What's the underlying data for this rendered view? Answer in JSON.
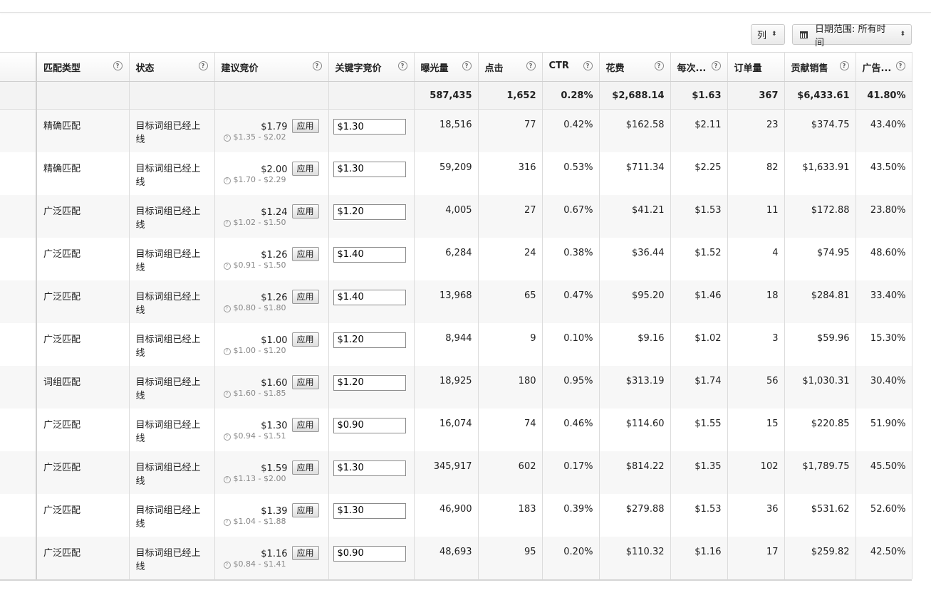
{
  "toolbar": {
    "columns_label": "列",
    "date_range_label": "日期范围: 所有时间"
  },
  "headers": [
    "匹配类型",
    "状态",
    "建议竞价",
    "关键字竞价",
    "曝光量",
    "点击",
    "CTR",
    "花费",
    "每次...",
    "订单量",
    "贡献销售",
    "广告..."
  ],
  "totals": {
    "impressions": "587,435",
    "clicks": "1,652",
    "ctr": "0.28%",
    "spend": "$2,688.14",
    "cpc": "$1.63",
    "orders": "367",
    "sales": "$6,433.61",
    "acos": "41.80%"
  },
  "apply_label": "应用",
  "rows": [
    {
      "match": "精确匹配",
      "status": "目标词组已经上线",
      "suggested": "$1.79",
      "range": "$1.35 - $2.02",
      "bid": "$1.30",
      "impressions": "18,516",
      "clicks": "77",
      "ctr": "0.42%",
      "spend": "$162.58",
      "cpc": "$2.11",
      "orders": "23",
      "sales": "$374.75",
      "acos": "43.40%"
    },
    {
      "match": "精确匹配",
      "status": "目标词组已经上线",
      "suggested": "$2.00",
      "range": "$1.70 - $2.29",
      "bid": "$1.30",
      "impressions": "59,209",
      "clicks": "316",
      "ctr": "0.53%",
      "spend": "$711.34",
      "cpc": "$2.25",
      "orders": "82",
      "sales": "$1,633.91",
      "acos": "43.50%"
    },
    {
      "match": "广泛匹配",
      "status": "目标词组已经上线",
      "suggested": "$1.24",
      "range": "$1.02 - $1.50",
      "bid": "$1.20",
      "impressions": "4,005",
      "clicks": "27",
      "ctr": "0.67%",
      "spend": "$41.21",
      "cpc": "$1.53",
      "orders": "11",
      "sales": "$172.88",
      "acos": "23.80%"
    },
    {
      "match": "广泛匹配",
      "status": "目标词组已经上线",
      "suggested": "$1.26",
      "range": "$0.91 - $1.50",
      "bid": "$1.40",
      "impressions": "6,284",
      "clicks": "24",
      "ctr": "0.38%",
      "spend": "$36.44",
      "cpc": "$1.52",
      "orders": "4",
      "sales": "$74.95",
      "acos": "48.60%"
    },
    {
      "match": "广泛匹配",
      "status": "目标词组已经上线",
      "suggested": "$1.26",
      "range": "$0.80 - $1.80",
      "bid": "$1.40",
      "impressions": "13,968",
      "clicks": "65",
      "ctr": "0.47%",
      "spend": "$95.20",
      "cpc": "$1.46",
      "orders": "18",
      "sales": "$284.81",
      "acos": "33.40%"
    },
    {
      "match": "广泛匹配",
      "status": "目标词组已经上线",
      "suggested": "$1.00",
      "range": "$1.00 - $1.20",
      "bid": "$1.20",
      "impressions": "8,944",
      "clicks": "9",
      "ctr": "0.10%",
      "spend": "$9.16",
      "cpc": "$1.02",
      "orders": "3",
      "sales": "$59.96",
      "acos": "15.30%"
    },
    {
      "match": "词组匹配",
      "status": "目标词组已经上线",
      "suggested": "$1.60",
      "range": "$1.60 - $1.85",
      "bid": "$1.20",
      "impressions": "18,925",
      "clicks": "180",
      "ctr": "0.95%",
      "spend": "$313.19",
      "cpc": "$1.74",
      "orders": "56",
      "sales": "$1,030.31",
      "acos": "30.40%"
    },
    {
      "match": "广泛匹配",
      "status": "目标词组已经上线",
      "suggested": "$1.30",
      "range": "$0.94 - $1.51",
      "bid": "$0.90",
      "impressions": "16,074",
      "clicks": "74",
      "ctr": "0.46%",
      "spend": "$114.60",
      "cpc": "$1.55",
      "orders": "15",
      "sales": "$220.85",
      "acos": "51.90%"
    },
    {
      "match": "广泛匹配",
      "status": "目标词组已经上线",
      "suggested": "$1.59",
      "range": "$1.13 - $2.00",
      "bid": "$1.30",
      "impressions": "345,917",
      "clicks": "602",
      "ctr": "0.17%",
      "spend": "$814.22",
      "cpc": "$1.35",
      "orders": "102",
      "sales": "$1,789.75",
      "acos": "45.50%"
    },
    {
      "match": "广泛匹配",
      "status": "目标词组已经上线",
      "suggested": "$1.39",
      "range": "$1.04 - $1.88",
      "bid": "$1.30",
      "impressions": "46,900",
      "clicks": "183",
      "ctr": "0.39%",
      "spend": "$279.88",
      "cpc": "$1.53",
      "orders": "36",
      "sales": "$531.62",
      "acos": "52.60%"
    },
    {
      "match": "广泛匹配",
      "status": "目标词组已经上线",
      "suggested": "$1.16",
      "range": "$0.84 - $1.41",
      "bid": "$0.90",
      "impressions": "48,693",
      "clicks": "95",
      "ctr": "0.20%",
      "spend": "$110.32",
      "cpc": "$1.16",
      "orders": "17",
      "sales": "$259.82",
      "acos": "42.50%"
    }
  ]
}
